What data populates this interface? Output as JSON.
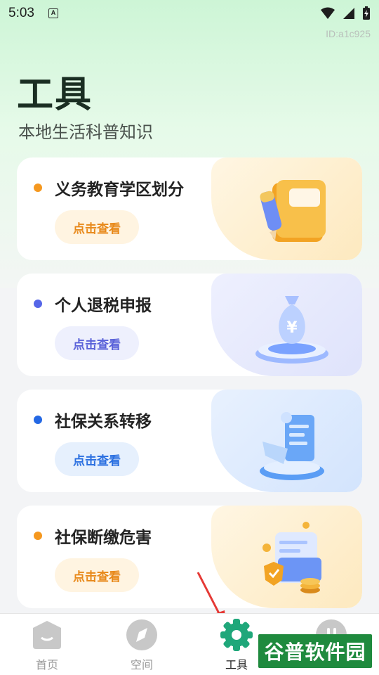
{
  "status_bar": {
    "time": "5:03",
    "notification_icon": "a-icon",
    "icons": [
      "wifi-icon",
      "signal-icon",
      "battery-charging-icon"
    ]
  },
  "id_label": "ID:a1c925",
  "header": {
    "title": "工具",
    "subtitle": "本地生活科普知识"
  },
  "cards": [
    {
      "title": "义务教育学区划分",
      "button": "点击查看",
      "dot_color": "#f5981f",
      "button_text_color": "#e8891a",
      "button_bg": "#fff4e1",
      "deco_bg": "#fdf1d5",
      "illustration": "book-pencil-icon"
    },
    {
      "title": "个人退税申报",
      "button": "点击查看",
      "dot_color": "#5566e8",
      "button_text_color": "#5a62d9",
      "button_bg": "#eef0fd",
      "deco_bg": "#e5e8fc",
      "illustration": "money-bag-icon"
    },
    {
      "title": "社保关系转移",
      "button": "点击查看",
      "dot_color": "#2468e4",
      "button_text_color": "#2a6fe0",
      "button_bg": "#e6f0fd",
      "deco_bg": "#dfeafd",
      "illustration": "transfer-document-icon"
    },
    {
      "title": "社保断缴危害",
      "button": "点击查看",
      "dot_color": "#f5981f",
      "button_text_color": "#e8891a",
      "button_bg": "#fff4e1",
      "deco_bg": "#fdf1d5",
      "illustration": "coins-card-shield-icon"
    }
  ],
  "tabbar": {
    "items": [
      {
        "label": "首页",
        "icon": "home-icon"
      },
      {
        "label": "空间",
        "icon": "compass-icon"
      },
      {
        "label": "工具",
        "icon": "gear-icon",
        "active": true
      },
      {
        "label": "",
        "icon": "profile-icon"
      }
    ]
  },
  "watermark": "谷普软件园",
  "colors": {
    "accent": "#1fa77a",
    "title": "#1a2e22"
  }
}
